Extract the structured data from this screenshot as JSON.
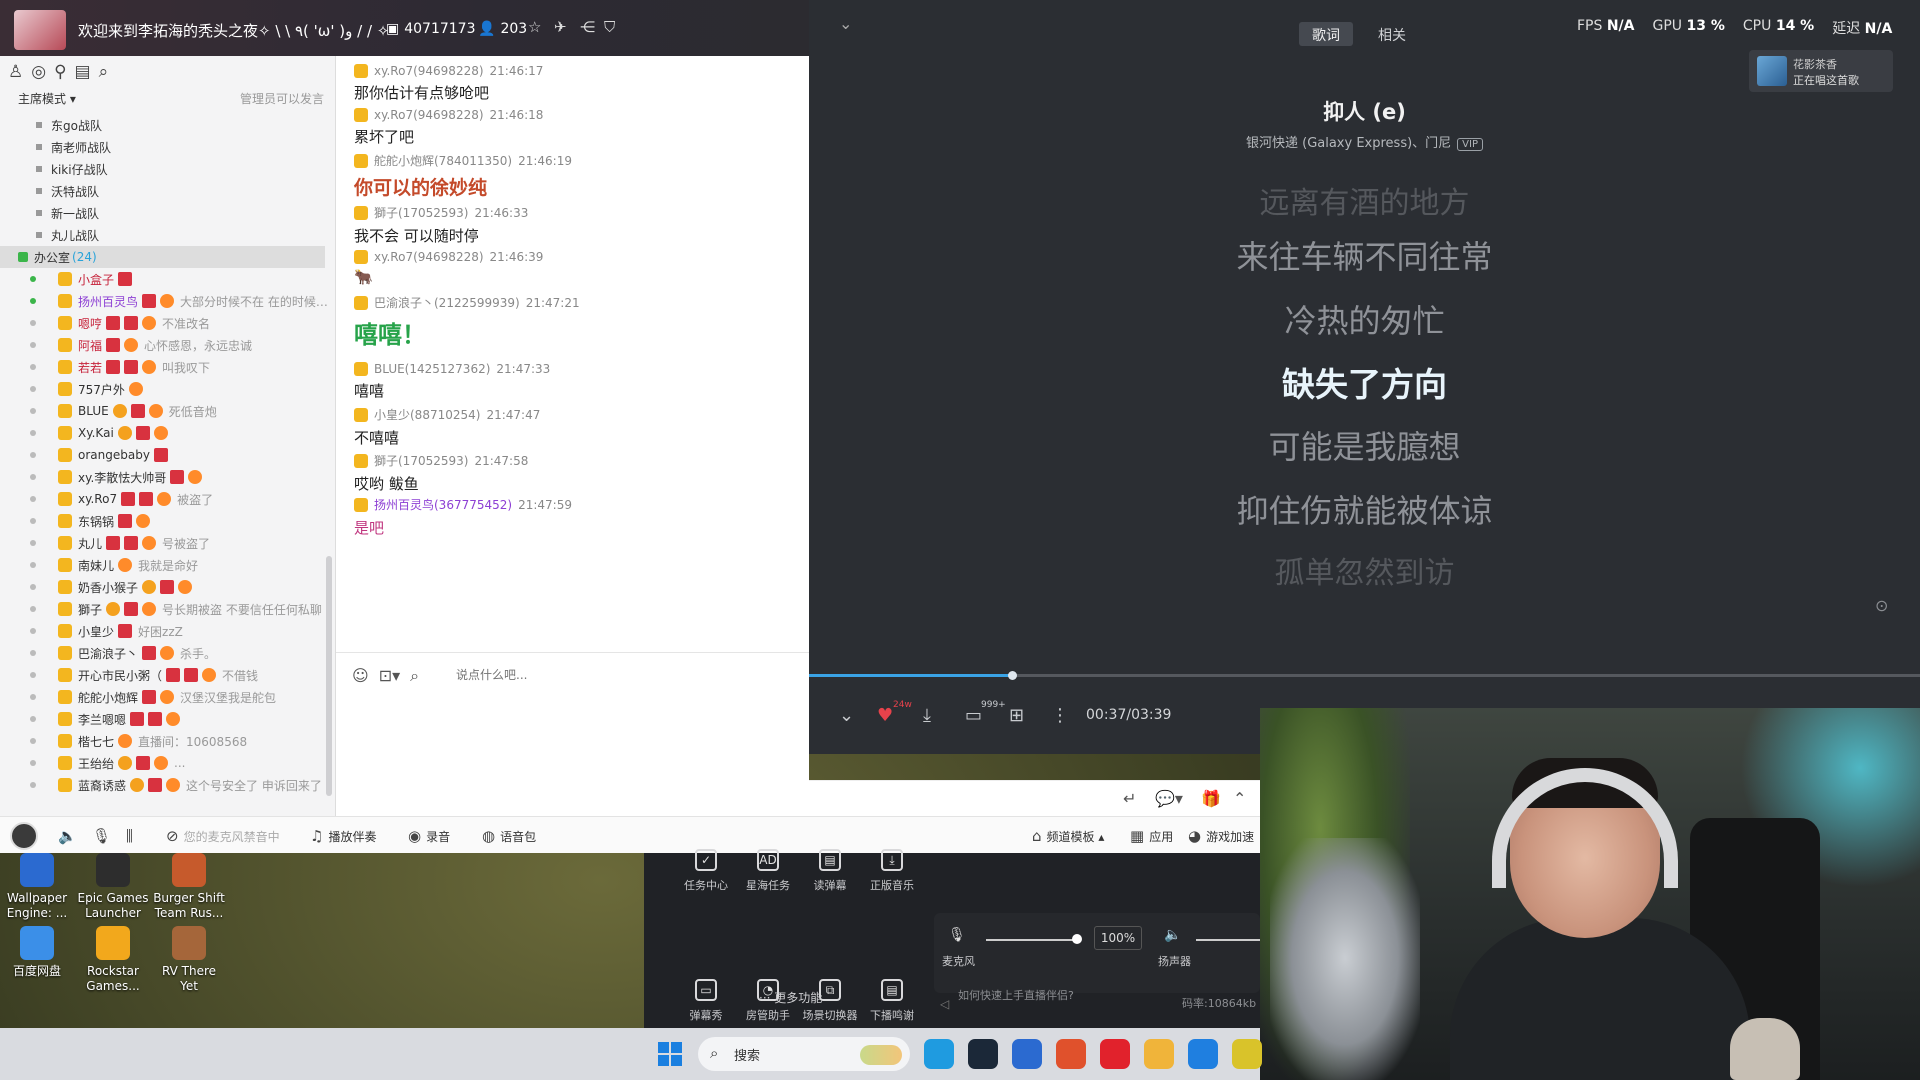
{
  "chat": {
    "room_title": "欢迎来到李拓海的秃头之夜✧ \\ \\ ٩( 'ω' )و / / ✧",
    "room_id": "40717173",
    "online_count": "203",
    "mode_label": "主席模式 ▾",
    "mode_note": "管理员可以发言",
    "teams": [
      "东go战队",
      "南老师战队",
      "kiki仔战队",
      "沃特战队",
      "新一战队",
      "丸儿战队"
    ],
    "room": {
      "name": "办公室",
      "count": "(24)"
    },
    "members": [
      {
        "name": "小盒子",
        "sig": "",
        "online": true,
        "style": "red"
      },
      {
        "name": "扬州百灵鸟",
        "sig": "大部分时候不在 在的时候不理",
        "online": true,
        "style": "purple"
      },
      {
        "name": "嗯哼",
        "sig": "不准改名",
        "online": false,
        "style": "red"
      },
      {
        "name": "阿福",
        "sig": "心怀感恩，永远忠诚",
        "online": false,
        "style": "red"
      },
      {
        "name": "若若",
        "sig": "叫我叹下",
        "online": false,
        "style": "red"
      },
      {
        "name": "757户外",
        "sig": "",
        "online": false,
        "style": ""
      },
      {
        "name": "BLUE",
        "sig": "死低音炮",
        "online": false,
        "style": ""
      },
      {
        "name": "Xy.Kai",
        "sig": "",
        "online": false,
        "style": ""
      },
      {
        "name": "orangebaby",
        "sig": "",
        "online": false,
        "style": ""
      },
      {
        "name": "xy.李散怯大帅哥",
        "sig": "",
        "online": false,
        "style": ""
      },
      {
        "name": "xy.Ro7",
        "sig": "被盗了",
        "online": false,
        "style": ""
      },
      {
        "name": "东锅锅",
        "sig": "",
        "online": false,
        "style": ""
      },
      {
        "name": "丸儿",
        "sig": "号被盗了",
        "online": false,
        "style": ""
      },
      {
        "name": "南妹儿",
        "sig": "我就是命好",
        "online": false,
        "style": ""
      },
      {
        "name": "奶香小猴子",
        "sig": "",
        "online": false,
        "style": ""
      },
      {
        "name": "獅子",
        "sig": "号长期被盗 不要信任任何私聊",
        "online": false,
        "style": ""
      },
      {
        "name": "小皇少",
        "sig": "好困zzZ",
        "online": false,
        "style": ""
      },
      {
        "name": "巴渝浪子丶",
        "sig": "杀手。",
        "online": false,
        "style": ""
      },
      {
        "name": "开心市民小粥（",
        "sig": "不借钱",
        "online": false,
        "style": ""
      },
      {
        "name": "舵舵小炮辉",
        "sig": "汉堡汉堡我是舵包",
        "online": false,
        "style": ""
      },
      {
        "name": "李兰嗯嗯",
        "sig": "",
        "online": false,
        "style": ""
      },
      {
        "name": "楷七七",
        "sig": "直播间：10608568",
        "online": false,
        "style": ""
      },
      {
        "name": "王绐绐",
        "sig": "...",
        "online": false,
        "style": ""
      },
      {
        "name": "蓝裔诱惑",
        "sig": "这个号安全了 申诉回来了",
        "online": false,
        "style": ""
      }
    ],
    "messages": [
      {
        "user": "xy.Ro7(94698228)",
        "time": "21:46:17",
        "text": "那你估计有点够呛吧",
        "style": ""
      },
      {
        "user": "xy.Ro7(94698228)",
        "time": "21:46:18",
        "text": "累坏了吧",
        "style": ""
      },
      {
        "user": "舵舵小炮辉(784011350)",
        "time": "21:46:19",
        "text": "你可以的徐妙纯",
        "style": "big-red"
      },
      {
        "user": "獅子(17052593)",
        "time": "21:46:33",
        "text": "我不会 可以随时停",
        "style": ""
      },
      {
        "user": "xy.Ro7(94698228)",
        "time": "21:46:39",
        "text": "🐂",
        "style": ""
      },
      {
        "user": "巴渝浪子丶(2122599939)",
        "time": "21:47:21",
        "text": "嘻嘻！",
        "style": "big-green"
      },
      {
        "user": "BLUE(1425127362)",
        "time": "21:47:33",
        "text": "嘻嘻",
        "style": ""
      },
      {
        "user": "小皇少(88710254)",
        "time": "21:47:47",
        "text": "不嘻嘻",
        "style": ""
      },
      {
        "user": "獅子(17052593)",
        "time": "21:47:58",
        "text": "哎哟 鲅鱼",
        "style": ""
      },
      {
        "user": "扬州百灵鸟(367775452)",
        "time": "21:47:59",
        "text": "是吧",
        "style": "pink"
      }
    ],
    "input_placeholder": "说点什么吧...",
    "bottombar": {
      "mic_status": "您的麦克风禁音中",
      "accompany": "播放伴奏",
      "record": "录音",
      "voice_pack": "语音包",
      "channel_template": "频道模板 ▴",
      "apps": "应用",
      "game_boost": "游戏加速"
    }
  },
  "music": {
    "tabs": [
      "歌词",
      "相关"
    ],
    "perf": {
      "fps_label": "FPS",
      "fps": "N/A",
      "gpu_label": "GPU",
      "gpu": "13 %",
      "cpu_label": "CPU",
      "cpu": "14 %",
      "latency_label": "延迟",
      "latency": "N/A"
    },
    "now_playing": {
      "line1": "花影茶香",
      "line2": "正在唱这首歌"
    },
    "song_title": "抑人 (e)",
    "artist": "银河快递 (Galaxy Express)、门尼",
    "vip": "VIP",
    "lyrics": [
      "远离有酒的地方",
      "来往车辆不同往常",
      "冷热的匆忙",
      "缺失了方向",
      "可能是我臆想",
      "抑住伤就能被体谅",
      "孤单忽然到访"
    ],
    "current_lyric_index": 3,
    "progress_fraction": 0.183,
    "heart_count": "24w",
    "comment_count": "999+",
    "time": "00:37/03:39"
  },
  "assistant": {
    "tools_row1": [
      "任务中心",
      "星海任务",
      "读弹幕",
      "正版音乐"
    ],
    "tools_row2": [
      "弹幕秀",
      "房管助手",
      "场景切换器",
      "下播鸣谢"
    ],
    "more": "··· 更多功能",
    "mic_label": "麦克风",
    "mic_value": "100%",
    "speaker_label": "扬声器",
    "help": "如何快速上手直播伴侣?",
    "bitrate": "码率:10864kb"
  },
  "desktop_icons": [
    {
      "label": "Wallpaper Engine: ...",
      "color": "#2b6ad0"
    },
    {
      "label": "Epic Games Launcher",
      "color": "#2d2d2d"
    },
    {
      "label": "Burger Shift Team Rus...",
      "color": "#c65a2c"
    },
    {
      "label": "百度网盘",
      "color": "#3b8fe8"
    },
    {
      "label": "Rockstar Games...",
      "color": "#f2a81c"
    },
    {
      "label": "RV There Yet",
      "color": "#a5663a"
    }
  ],
  "taskbar": {
    "search_placeholder": "搜索",
    "apps": [
      {
        "name": "edge-app",
        "color": "#1f9be0"
      },
      {
        "name": "steam-app",
        "color": "#1b2838"
      },
      {
        "name": "word-app",
        "color": "#2b6ad0"
      },
      {
        "name": "game-app",
        "color": "#e0512c"
      },
      {
        "name": "netease-music-app",
        "color": "#e1222c"
      },
      {
        "name": "panda-app",
        "color": "#f0b43a"
      },
      {
        "name": "kugou-app",
        "color": "#1f7fe0"
      },
      {
        "name": "obs-app",
        "color": "#d9c32a"
      }
    ]
  }
}
